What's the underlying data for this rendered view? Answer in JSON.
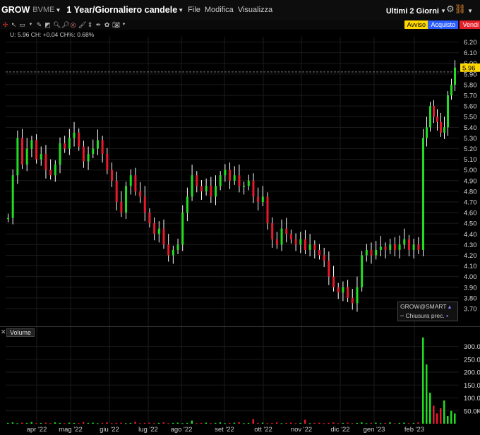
{
  "header": {
    "ticker": "GROW",
    "exchange": "BVME",
    "period": "1 Year/Giornaliero candele",
    "menus": [
      "File",
      "Modifica",
      "Visualizza"
    ],
    "range_selector": "Ultimi 2 Giorni"
  },
  "actions": {
    "avviso": "Avviso",
    "acquisto": "Acquisto",
    "vendi": "Vendi"
  },
  "readout": "U: 5.96 CH: +0.04 CH%: 0.68%",
  "price_label": "5.96",
  "volume_label": "Volume",
  "legend": {
    "symbol": "GROW@SMART",
    "close_label": "Chiusura prec."
  },
  "colors": {
    "up": "#22dd22",
    "down": "#e8192c",
    "neutral": "#ffffff",
    "price_tag": "#ffd800"
  },
  "chart_data": [
    {
      "type": "candlestick",
      "price_axis": {
        "ticks": [
          "6.20",
          "6.10",
          "6.00",
          "5.90",
          "5.80",
          "5.70",
          "5.60",
          "5.50",
          "5.40",
          "5.30",
          "5.20",
          "5.10",
          "5.00",
          "4.90",
          "4.80",
          "4.70",
          "4.60",
          "4.50",
          "4.40",
          "4.30",
          "4.20",
          "4.10",
          "4.00",
          "3.90",
          "3.80",
          "3.70"
        ],
        "range": [
          3.64,
          6.25
        ]
      },
      "x_ticks": [
        "apr '22",
        "mag '22",
        "giu '22",
        "lug '22",
        "ago '22",
        "set '22",
        "ott '22",
        "nov '22",
        "dic '22",
        "gen '23",
        "feb '23"
      ],
      "last": 5.96,
      "previous_close_line": 5.92,
      "closes": [
        4.55,
        4.95,
        5.3,
        5.05,
        5.2,
        5.28,
        5.1,
        5.15,
        5.0,
        4.95,
        5.05,
        5.25,
        5.2,
        5.3,
        5.35,
        5.22,
        5.08,
        5.15,
        5.2,
        5.28,
        5.15,
        5.0,
        4.9,
        4.7,
        4.6,
        4.85,
        4.95,
        4.8,
        4.75,
        4.6,
        4.5,
        4.4,
        4.45,
        4.3,
        4.2,
        4.25,
        4.3,
        4.6,
        4.75,
        4.95,
        4.85,
        4.8,
        4.85,
        4.75,
        4.85,
        4.95,
        5.0,
        4.9,
        4.95,
        4.85,
        4.85,
        4.9,
        4.75,
        4.7,
        4.75,
        4.5,
        4.35,
        4.3,
        4.45,
        4.4,
        4.35,
        4.3,
        4.35,
        4.25,
        4.3,
        4.25,
        4.2,
        4.15,
        4.0,
        3.9,
        3.85,
        3.9,
        3.8,
        3.75,
        3.9,
        4.2,
        4.25,
        4.2,
        4.25,
        4.28,
        4.25,
        4.3,
        4.25,
        4.3,
        4.35,
        4.25,
        4.3,
        4.25,
        5.3,
        5.4,
        5.6,
        5.5,
        5.45,
        5.35,
        5.4,
        5.7,
        5.8,
        5.96
      ]
    },
    {
      "type": "bar",
      "title": "Volume",
      "y_axis": {
        "ticks": [
          "300.0K",
          "250.0K",
          "200.0K",
          "150.0K",
          "100.0K",
          "50.0K"
        ],
        "range": [
          0,
          340000
        ]
      },
      "values": [
        3000,
        5000,
        2000,
        4000,
        3000,
        6000,
        2000,
        3000,
        4000,
        2000,
        5000,
        3000,
        2000,
        4000,
        3000,
        2000,
        6000,
        3000,
        4000,
        2000,
        3000,
        5000,
        2000,
        3000,
        4000,
        2000,
        3000,
        7000,
        2000,
        3000,
        4000,
        2000,
        3000,
        5000,
        2000,
        3000,
        4000,
        2000,
        3000,
        12000,
        2000,
        3000,
        4000,
        2000,
        3000,
        5000,
        2000,
        3000,
        4000,
        6000,
        2000,
        3000,
        18000,
        3000,
        4000,
        2000,
        3000,
        5000,
        2000,
        3000,
        4000,
        2000,
        3000,
        15000,
        2000,
        3000,
        4000,
        2000,
        3000,
        5000,
        2000,
        3000,
        4000,
        2000,
        3000,
        5000,
        2000,
        3000,
        4000,
        2000,
        3000,
        5000,
        2000,
        3000,
        4000,
        2000,
        3000,
        5000,
        335000,
        230000,
        120000,
        70000,
        40000,
        60000,
        90000,
        30000,
        50000,
        40000
      ]
    }
  ]
}
